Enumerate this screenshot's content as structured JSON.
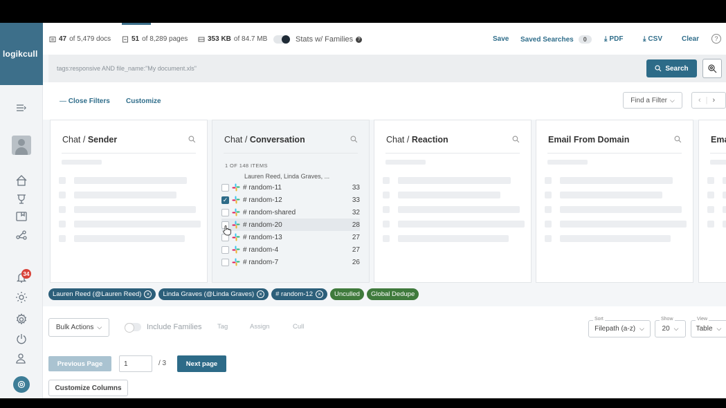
{
  "app": {
    "logo": "logikcull"
  },
  "rail": {
    "notifications_count": "34"
  },
  "stats": {
    "docs_count": "47",
    "docs_suffix": "of 5,479 docs",
    "pages_count": "51",
    "pages_suffix": "of 8,289 pages",
    "size_count": "353 KB",
    "size_suffix": "of 84.7 MB",
    "families_label": "Stats w/ Families"
  },
  "top_actions": {
    "save": "Save",
    "saved_searches": "Saved Searches",
    "saved_searches_count": "0",
    "pdf": "PDF",
    "csv": "CSV",
    "clear": "Clear",
    "help": "?"
  },
  "search": {
    "query": "tags:responsive AND file_name:\"My document.xls\"",
    "button": "Search"
  },
  "filter_bar": {
    "close_filters": "Close Filters",
    "customize": "Customize",
    "find_filter": "Find a Filter"
  },
  "panels": {
    "sender": {
      "prefix": "Chat / ",
      "title": "Sender"
    },
    "conversation": {
      "prefix": "Chat / ",
      "title": "Conversation",
      "count_line": "1 OF 148 ITEMS",
      "truncated": "Lauren Reed, Linda Graves, ...",
      "items": [
        {
          "name": "# random-11",
          "count": "33",
          "checked": false
        },
        {
          "name": "# random-12",
          "count": "33",
          "checked": true
        },
        {
          "name": "# random-shared",
          "count": "32",
          "checked": false
        },
        {
          "name": "# random-20",
          "count": "28",
          "checked": false
        },
        {
          "name": "# random-13",
          "count": "27",
          "checked": false
        },
        {
          "name": "# random-4",
          "count": "27",
          "checked": false
        },
        {
          "name": "# random-7",
          "count": "26",
          "checked": false
        }
      ]
    },
    "reaction": {
      "prefix": "Chat / ",
      "title": "Reaction"
    },
    "email_domain": {
      "title": "Email From Domain"
    },
    "em_cut": {
      "title": "Ema"
    }
  },
  "chips": [
    {
      "label": "Lauren Reed (@Lauren Reed)",
      "style": "dark",
      "removable": true
    },
    {
      "label": "Linda Graves (@Linda Graves)",
      "style": "dark",
      "removable": true
    },
    {
      "label": "# random-12",
      "style": "dark",
      "removable": true
    },
    {
      "label": "Unculled",
      "style": "green",
      "removable": false
    },
    {
      "label": "Global Dedupe",
      "style": "green",
      "removable": false
    }
  ],
  "actions": {
    "bulk": "Bulk Actions",
    "include_families": "Include Families",
    "tag": "Tag",
    "assign": "Assign",
    "cull": "Cull",
    "sort_legend": "Sort",
    "sort_value": "Filepath (a-z)",
    "show_legend": "Show",
    "show_value": "20",
    "view_legend": "View",
    "view_value": "Table"
  },
  "pagination": {
    "previous": "Previous Page",
    "current": "1",
    "total": "/ 3",
    "next": "Next page"
  },
  "customize_columns": "Customize Columns",
  "colors": {
    "primary": "#2d6b88",
    "logo_bg": "#3d6f8a",
    "chip_green": "#3f7a3c",
    "badge_red": "#d8433a"
  }
}
